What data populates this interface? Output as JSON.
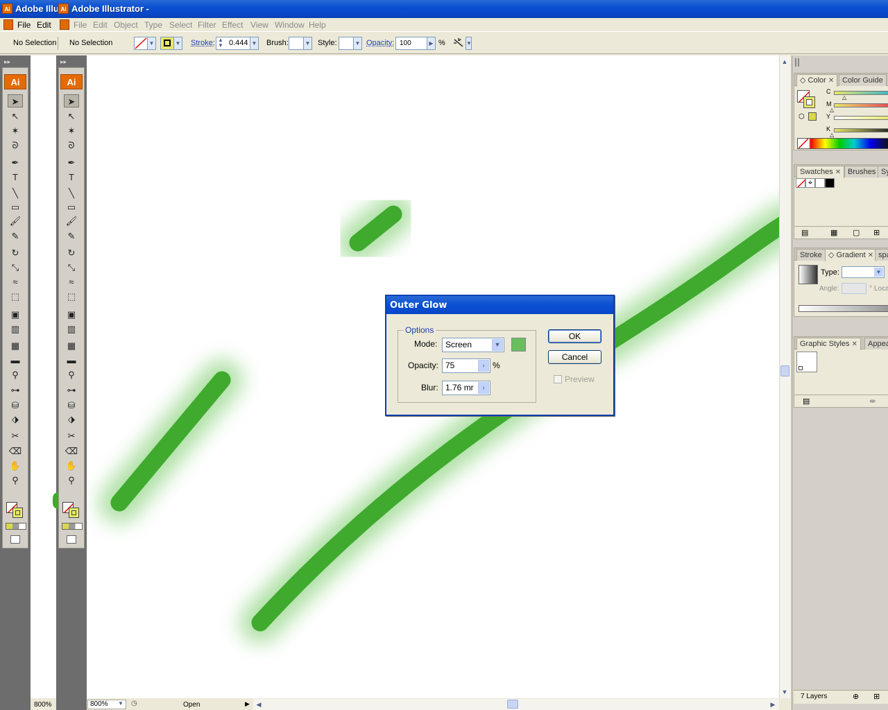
{
  "windows": {
    "back_title": "Adobe Illu",
    "front_title": "Adobe Illustrator -",
    "app_icon_label": "Ai"
  },
  "menubar": {
    "back_items": [
      "File",
      "Edit"
    ],
    "front_items": [
      "File",
      "Edit",
      "Object",
      "Type",
      "Select",
      "Filter",
      "Effect",
      "View",
      "Window",
      "Help"
    ]
  },
  "controlbar": {
    "back_selection": "No Selection",
    "selection": "No Selection",
    "stroke_label": "Stroke:",
    "stroke_value": "0.444",
    "brush_label": "Brush:",
    "style_label": "Style:",
    "opacity_label": "Opacity:",
    "opacity_value": "100",
    "opacity_unit": "%"
  },
  "toolbox": {
    "logo": "Ai",
    "tools": [
      "selection",
      "direct-selection",
      "magic-wand",
      "lasso",
      "pen",
      "type",
      "line-segment",
      "rectangle",
      "paintbrush",
      "pencil",
      "rotate",
      "scale",
      "warp",
      "free-transform",
      "symbol-sprayer",
      "column-graph",
      "mesh",
      "gradient",
      "eyedropper",
      "blend",
      "live-paint-bucket",
      "live-paint-selection",
      "slice",
      "eraser",
      "hand",
      "zoom"
    ]
  },
  "status": {
    "back_zoom": "800%",
    "zoom": "800%",
    "status_text": "Open"
  },
  "panels": {
    "color": {
      "tabs": [
        "Color",
        "Color Guide"
      ],
      "sliders": [
        "C",
        "M",
        "Y",
        "K"
      ]
    },
    "swatches": {
      "tabs": [
        "Swatches",
        "Brushes",
        "Sy"
      ]
    },
    "gradient": {
      "tabs": [
        "Stroke",
        "Gradient",
        "spar"
      ],
      "type_label": "Type:",
      "angle_label": "Angle:",
      "angle_unit": "°",
      "location_label": "Loca"
    },
    "graphic_styles": {
      "tabs": [
        "Graphic Styles",
        "Appea"
      ]
    },
    "layers": {
      "count_label": "7 Layers"
    }
  },
  "dialog": {
    "title": "Outer Glow",
    "group_label": "Options",
    "mode_label": "Mode:",
    "mode_value": "Screen",
    "glow_color": "#6abe5e",
    "opacity_label": "Opacity:",
    "opacity_value": "75",
    "opacity_unit": "%",
    "blur_label": "Blur:",
    "blur_value": "1.76 mr",
    "ok_label": "OK",
    "cancel_label": "Cancel",
    "preview_label": "Preview",
    "preview_checked": false
  },
  "artwork": {
    "stroke_color": "#3faa2e",
    "glow_color": "#8fd17f"
  }
}
